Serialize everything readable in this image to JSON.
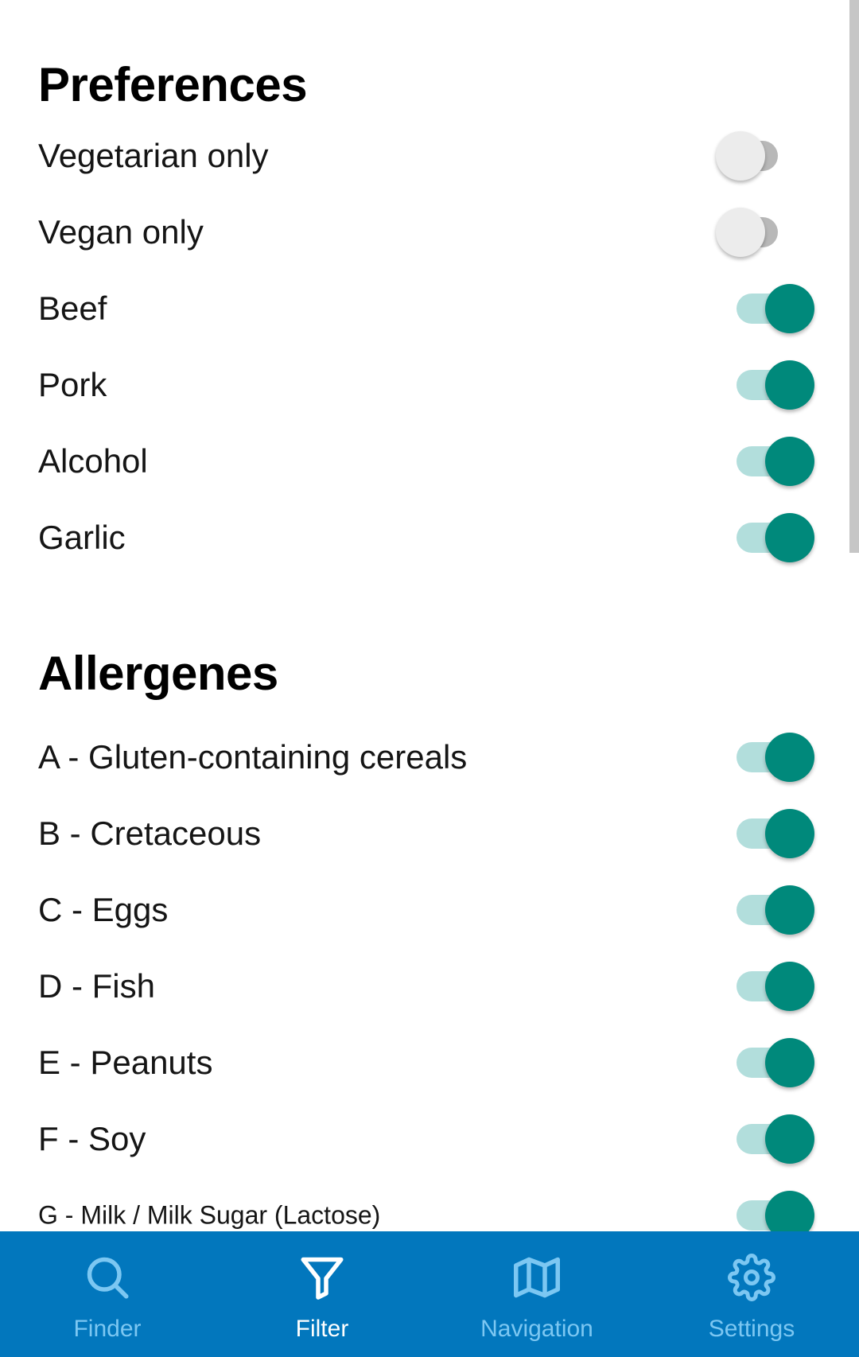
{
  "preferences": {
    "title": "Preferences",
    "items": [
      {
        "label": "Vegetarian only",
        "on": false
      },
      {
        "label": "Vegan only",
        "on": false
      },
      {
        "label": "Beef",
        "on": true
      },
      {
        "label": "Pork",
        "on": true
      },
      {
        "label": "Alcohol",
        "on": true
      },
      {
        "label": "Garlic",
        "on": true
      }
    ]
  },
  "allergenes": {
    "title": "Allergenes",
    "items": [
      {
        "label": "A - Gluten-containing cereals",
        "on": true
      },
      {
        "label": "B - Cretaceous",
        "on": true
      },
      {
        "label": "C - Eggs",
        "on": true
      },
      {
        "label": "D - Fish",
        "on": true
      },
      {
        "label": "E - Peanuts",
        "on": true
      },
      {
        "label": "F - Soy",
        "on": true
      },
      {
        "label": "G - Milk / Milk Sugar (Lactose)",
        "on": true
      }
    ]
  },
  "colors": {
    "accent": "#00897b",
    "accent_track": "#b2dedc",
    "nav_background": "#0277bd",
    "nav_inactive": "#7cc7f2",
    "nav_active": "#ffffff"
  },
  "bottom_nav": {
    "items": [
      {
        "label": "Finder",
        "icon": "search-icon",
        "active": false
      },
      {
        "label": "Filter",
        "icon": "filter-icon",
        "active": true
      },
      {
        "label": "Navigation",
        "icon": "map-icon",
        "active": false
      },
      {
        "label": "Settings",
        "icon": "gear-icon",
        "active": false
      }
    ]
  }
}
